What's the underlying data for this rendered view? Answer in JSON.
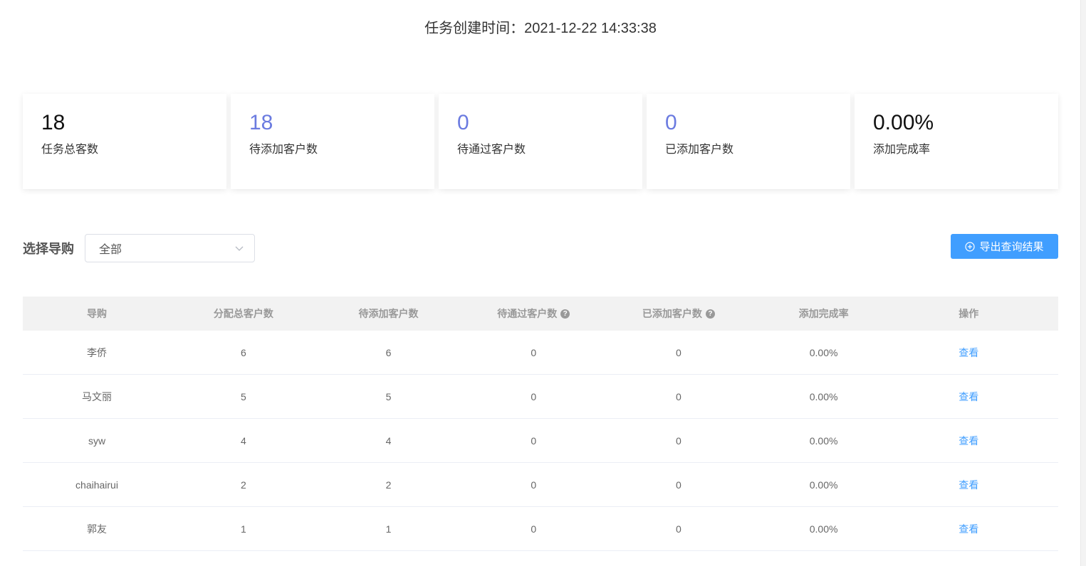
{
  "header": {
    "created_time_text": "任务创建时间：2021-12-22 14:33:38"
  },
  "stats": [
    {
      "value": "18",
      "label": "任务总客数"
    },
    {
      "value": "18",
      "label": "待添加客户数"
    },
    {
      "value": "0",
      "label": "待通过客户数"
    },
    {
      "value": "0",
      "label": "已添加客户数"
    },
    {
      "value": "0.00%",
      "label": "添加完成率"
    }
  ],
  "filter": {
    "label": "选择导购",
    "selected": "全部"
  },
  "export_button": {
    "label": "导出查询结果"
  },
  "table": {
    "headers": [
      "导购",
      "分配总客户数",
      "待添加客户数",
      "待通过客户数",
      "已添加客户数",
      "添加完成率",
      "操作"
    ],
    "help_glyph": "?",
    "rows": [
      [
        "李侨",
        "6",
        "6",
        "0",
        "0",
        "0.00%",
        "查看"
      ],
      [
        "马文丽",
        "5",
        "5",
        "0",
        "0",
        "0.00%",
        "查看"
      ],
      [
        "syw",
        "4",
        "4",
        "0",
        "0",
        "0.00%",
        "查看"
      ],
      [
        "chaihairui",
        "2",
        "2",
        "0",
        "0",
        "0.00%",
        "查看"
      ],
      [
        "郭友",
        "1",
        "1",
        "0",
        "0",
        "0.00%",
        "查看"
      ]
    ]
  },
  "colors": {
    "accent_value": "#6b7be0",
    "primary": "#409eff"
  },
  "icons": {
    "select_arrow": "chevron-down-icon",
    "export": "plus-circle-icon",
    "header_help": "question-circle-icon"
  }
}
